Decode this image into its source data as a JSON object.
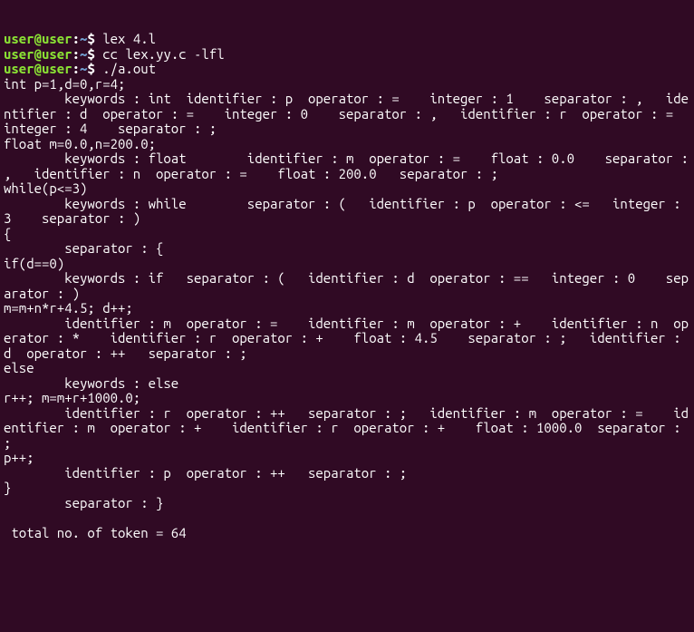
{
  "prompt": {
    "user": "user@user",
    "sep": ":",
    "path": "~",
    "dollar": "$ "
  },
  "commands": [
    "lex 4.l",
    "cc lex.yy.c -lfl",
    "./a.out"
  ],
  "output": "int p=1,d=0,r=4;\n        keywords : int  identifier : p  operator : =    integer : 1    separator : ,   identifier : d  operator : =    integer : 0    separator : ,   identifier : r  operator : =    integer : 4    separator : ;\nfloat m=0.0,n=200.0;\n        keywords : float        identifier : m  operator : =    float : 0.0    separator : ,   identifier : n  operator : =    float : 200.0   separator : ;\nwhile(p<=3)\n        keywords : while        separator : (   identifier : p  operator : <=   integer : 3    separator : )\n{\n        separator : {\nif(d==0)\n        keywords : if   separator : (   identifier : d  operator : ==   integer : 0    separator : )\nm=m+n*r+4.5; d++;\n        identifier : m  operator : =    identifier : m  operator : +    identifier : n  operator : *    identifier : r  operator : +    float : 4.5    separator : ;   identifier : d  operator : ++   separator : ;\nelse\n        keywords : else\nr++; m=m+r+1000.0;\n        identifier : r  operator : ++   separator : ;   identifier : m  operator : =    identifier : m  operator : +    identifier : r  operator : +    float : 1000.0  separator : ;\np++;\n        identifier : p  operator : ++   separator : ;\n}\n        separator : }\n\n total no. of token = 64"
}
